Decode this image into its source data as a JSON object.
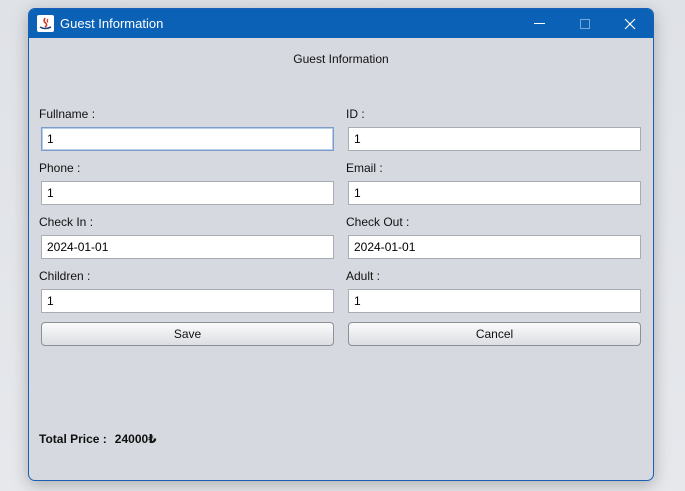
{
  "window": {
    "title": "Guest Information",
    "icon": "java-app-icon"
  },
  "form": {
    "heading": "Guest Information",
    "fields": {
      "fullname": {
        "label": "Fullname :",
        "value": "1"
      },
      "id": {
        "label": "ID :",
        "value": "1"
      },
      "phone": {
        "label": "Phone :",
        "value": "1"
      },
      "email": {
        "label": "Email :",
        "value": "1"
      },
      "check_in": {
        "label": "Check In :",
        "value": "2024-01-01"
      },
      "check_out": {
        "label": "Check Out :",
        "value": "2024-01-01"
      },
      "children": {
        "label": "Children :",
        "value": "1"
      },
      "adult": {
        "label": "Adult :",
        "value": "1"
      }
    },
    "buttons": {
      "save": "Save",
      "cancel": "Cancel"
    },
    "total": {
      "label": "Total Price :",
      "value": "24000₺"
    }
  },
  "colors": {
    "titlebar": "#0a61b6",
    "window_bg": "#d6d9e0"
  }
}
